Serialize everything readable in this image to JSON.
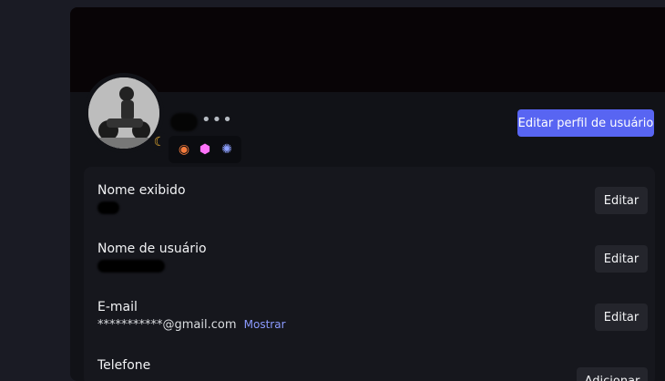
{
  "profile": {
    "edit_profile_label": "Editar perfil de usuário",
    "more_label": "•••",
    "status_icon": "moon-icon"
  },
  "badges": [
    {
      "name": "nitro-badge-icon",
      "color": "#f47b3c"
    },
    {
      "name": "boost-badge-icon",
      "color": "#ff73fa"
    },
    {
      "name": "quest-badge-icon",
      "color": "#8ea1ff"
    }
  ],
  "fields": {
    "display_name": {
      "label": "Nome exibido",
      "button": "Editar"
    },
    "username": {
      "label": "Nome de usuário",
      "button": "Editar"
    },
    "email": {
      "label": "E-mail",
      "value": "***********@gmail.com",
      "reveal": "Mostrar",
      "button": "Editar"
    },
    "phone": {
      "label": "Telefone",
      "button": "Adicionar"
    }
  }
}
